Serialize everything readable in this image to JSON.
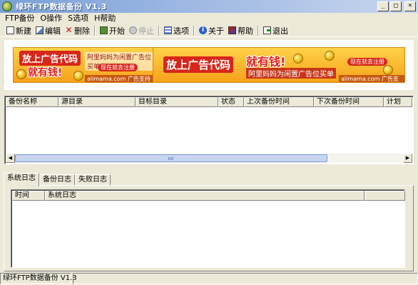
{
  "window": {
    "title": "绿环FTP数据备份 V1.3",
    "controls": {
      "minimize": "_",
      "maximize": "□",
      "close": "×"
    }
  },
  "menu": [
    "FTP备份",
    "O操作",
    "S选项",
    "H帮助"
  ],
  "toolbar": {
    "new": "新建",
    "edit": "编辑",
    "delete": "删除",
    "start": "开始",
    "stop": "停止",
    "options": "选项",
    "about": "关于",
    "help": "帮助",
    "exit": "退出"
  },
  "ads": [
    {
      "main": "放上广告代码",
      "sub": "就有钱!",
      "line": "阿里妈妈为闲置广告位买单",
      "cta": "现在就去注册",
      "foot": "alimama.com 广告支持"
    },
    {
      "main": "放上广告代码",
      "sub": "就有钱!",
      "line": "阿里妈妈为闲置广告位买单",
      "cta": "现在就去注册",
      "foot": "alimama.com 广告支持"
    }
  ],
  "backup_table": {
    "columns": [
      "备份名称",
      "源目录",
      "目标目录",
      "状态",
      "上次备份时间",
      "下次备份时间",
      "计划"
    ],
    "rows": []
  },
  "scrollbar": {
    "left": "◀",
    "right": "▶"
  },
  "log_tabs": [
    "系统日志",
    "备份日志",
    "失败日志"
  ],
  "active_log_tab": "系统日志",
  "log_table": {
    "columns": [
      "时间",
      "系统日志"
    ],
    "rows": []
  },
  "status": [
    "绿环FTP数据备份 V1.3",
    ""
  ]
}
